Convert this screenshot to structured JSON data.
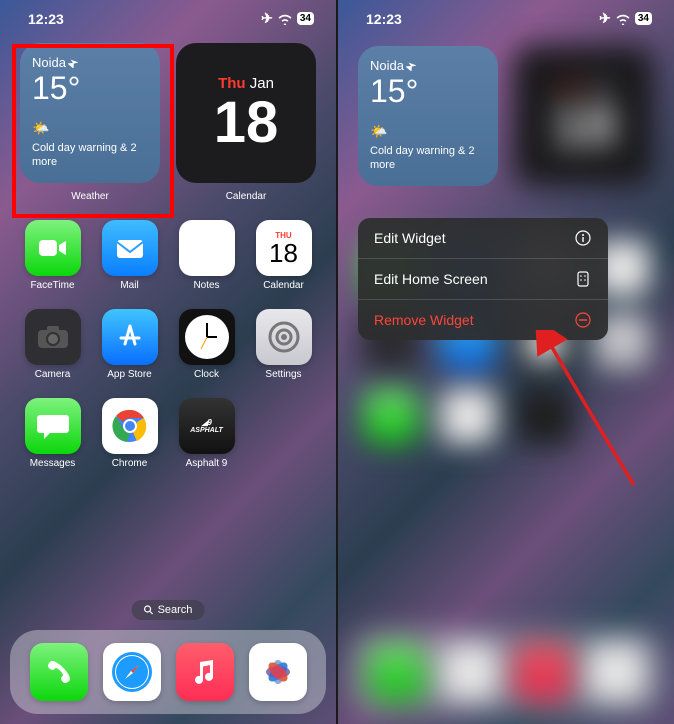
{
  "status": {
    "time": "12:23",
    "battery": "34"
  },
  "weather": {
    "location": "Noida",
    "temp": "15°",
    "warning": "Cold day warning & 2 more",
    "label": "Weather"
  },
  "calendar": {
    "dow": "Thu",
    "month": "Jan",
    "day": "18",
    "label": "Calendar"
  },
  "apps": {
    "facetime": "FaceTime",
    "mail": "Mail",
    "notes": "Notes",
    "calendar": "Calendar",
    "camera": "Camera",
    "appstore": "App Store",
    "clock": "Clock",
    "settings": "Settings",
    "messages": "Messages",
    "chrome": "Chrome",
    "asphalt": "Asphalt 9",
    "cal_dow": "THU",
    "cal_num": "18"
  },
  "search": "Search",
  "menu": {
    "edit_widget": "Edit Widget",
    "edit_home": "Edit Home Screen",
    "remove": "Remove Widget"
  }
}
